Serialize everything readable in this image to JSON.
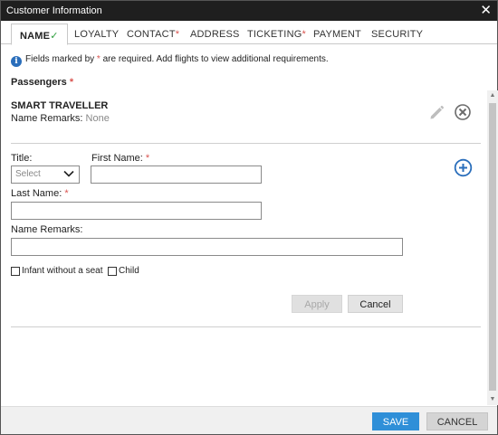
{
  "window": {
    "title": "Customer Information",
    "close_glyph": "✕"
  },
  "tabs": [
    {
      "label": "NAME",
      "active": true,
      "completed_mark": "✓"
    },
    {
      "label": "LOYALTY"
    },
    {
      "label": "CONTACT",
      "required": "*"
    },
    {
      "label": "ADDRESS"
    },
    {
      "label": "TICKETING",
      "required": "*"
    },
    {
      "label": "PAYMENT"
    },
    {
      "label": "SECURITY"
    }
  ],
  "notice": {
    "icon": "info-icon",
    "icon_glyph": "i",
    "text_before": "Fields marked by ",
    "asterisk": "*",
    "text_after": " are required. Add flights to view additional requirements."
  },
  "passengers": {
    "label": "Passengers",
    "required": "*",
    "current": {
      "name": "SMART TRAVELLER",
      "remarks_label": "Name Remarks:",
      "remarks_value": "None"
    },
    "edit_icon": "pencil-icon",
    "remove_icon": "circle-x-icon",
    "add_icon": "circle-plus-icon"
  },
  "form": {
    "title_label": "Title:",
    "title_placeholder": "Select",
    "first_name_label": "First Name:",
    "first_name_value": "",
    "last_name_label": "Last Name:",
    "last_name_value": "",
    "name_remarks_label": "Name Remarks:",
    "name_remarks_value": "",
    "required_mark": "*",
    "infant_label": "Infant without a seat",
    "child_label": "Child",
    "apply_label": "Apply",
    "cancel_label": "Cancel"
  },
  "footer": {
    "save_label": "SAVE",
    "cancel_label": "CANCEL"
  },
  "colors": {
    "title_bar": "#1f1f1f",
    "accent_blue": "#2a6ebb",
    "save_button": "#2f8fd8",
    "required_red": "#d9534f",
    "check_green": "#2e9e3e"
  }
}
